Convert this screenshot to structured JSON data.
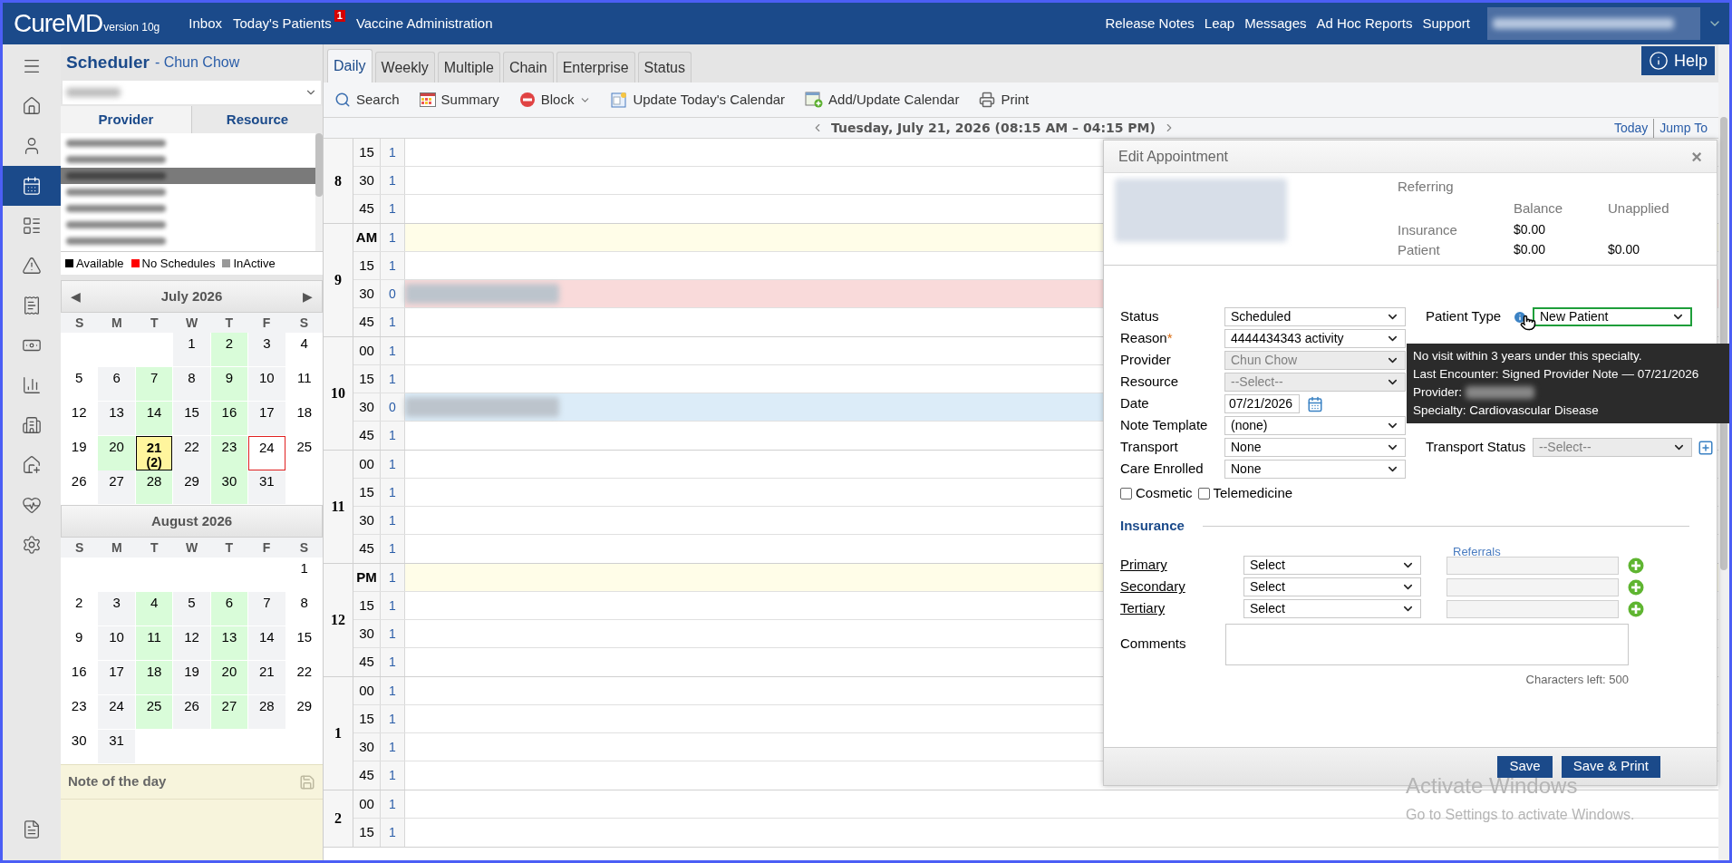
{
  "topbar": {
    "logo": "CureMD",
    "version": "version 10g",
    "links": [
      {
        "label": "Inbox"
      },
      {
        "label": "Today's Patients",
        "badge": "1"
      },
      {
        "label": "Vaccine Administration"
      }
    ],
    "right_links": [
      "Release Notes",
      "Leap",
      "Messages",
      "Ad Hoc Reports",
      "Support"
    ]
  },
  "rail": [
    {
      "kind": "menu",
      "selected": false
    },
    {
      "kind": "home",
      "selected": false
    },
    {
      "kind": "user",
      "selected": false
    },
    {
      "kind": "calendar",
      "selected": true
    },
    {
      "kind": "ledger",
      "selected": false
    },
    {
      "kind": "alert",
      "selected": false
    },
    {
      "kind": "billing",
      "selected": false
    },
    {
      "kind": "payments",
      "selected": false
    },
    {
      "kind": "reports",
      "selected": false
    },
    {
      "kind": "facility",
      "selected": false
    },
    {
      "kind": "homecare",
      "selected": false
    },
    {
      "kind": "health",
      "selected": false
    },
    {
      "kind": "settings",
      "selected": false
    },
    {
      "kind": "notes",
      "selected": false
    }
  ],
  "scheduler": {
    "title": "Scheduler",
    "subtitle": "- Chun Chow"
  },
  "panel_tabs": [
    {
      "label": "Provider",
      "selected": true
    },
    {
      "label": "Resource",
      "selected": false
    }
  ],
  "provider_list": [
    {
      "selected": false
    },
    {
      "selected": false
    },
    {
      "selected": true
    },
    {
      "selected": false
    },
    {
      "selected": false
    },
    {
      "selected": false
    },
    {
      "selected": false
    }
  ],
  "legend": [
    {
      "label": "Available",
      "color": "#000000"
    },
    {
      "label": "No Schedules",
      "color": "#ff0000"
    },
    {
      "label": "InActive",
      "color": "#999999"
    }
  ],
  "months": [
    {
      "title": "July 2026",
      "prev": "◀",
      "next": "▶",
      "weekdays": [
        "S",
        "M",
        "T",
        "W",
        "T",
        "F",
        "S"
      ],
      "weeks": [
        [
          {
            "kind": "empty"
          },
          {
            "kind": "empty"
          },
          {
            "kind": "empty"
          },
          {
            "d": "1",
            "kind": "closed",
            "selected": false
          },
          {
            "d": "2",
            "kind": "open",
            "selected": false
          },
          {
            "d": "3",
            "kind": "closed",
            "selected": false
          },
          {
            "d": "4",
            "kind": "weekend",
            "selected": false
          }
        ],
        [
          {
            "d": "5",
            "kind": "weekend",
            "selected": false
          },
          {
            "d": "6",
            "kind": "closed",
            "selected": false
          },
          {
            "d": "7",
            "kind": "open",
            "selected": false
          },
          {
            "d": "8",
            "kind": "closed",
            "selected": false
          },
          {
            "d": "9",
            "kind": "open",
            "selected": false
          },
          {
            "d": "10",
            "kind": "closed",
            "selected": false
          },
          {
            "d": "11",
            "kind": "weekend",
            "selected": false
          }
        ],
        [
          {
            "d": "12",
            "kind": "weekend",
            "selected": false
          },
          {
            "d": "13",
            "kind": "closed",
            "selected": false
          },
          {
            "d": "14",
            "kind": "open",
            "selected": false
          },
          {
            "d": "15",
            "kind": "closed",
            "selected": false
          },
          {
            "d": "16",
            "kind": "open",
            "selected": false
          },
          {
            "d": "17",
            "kind": "closed",
            "selected": false
          },
          {
            "d": "18",
            "kind": "weekend",
            "selected": false
          }
        ],
        [
          {
            "d": "19",
            "kind": "weekend",
            "selected": false
          },
          {
            "d": "20",
            "kind": "open",
            "selected": false
          },
          {
            "d": "21",
            "selected": true,
            "count": "(2)"
          },
          {
            "d": "22",
            "kind": "closed",
            "selected": false
          },
          {
            "d": "23",
            "kind": "open",
            "selected": false
          },
          {
            "d": "24",
            "kind": "flagged",
            "selected": false
          },
          {
            "d": "25",
            "kind": "weekend",
            "selected": false
          }
        ],
        [
          {
            "d": "26",
            "kind": "weekend",
            "selected": false
          },
          {
            "d": "27",
            "kind": "closed",
            "selected": false
          },
          {
            "d": "28",
            "kind": "open",
            "selected": false
          },
          {
            "d": "29",
            "kind": "closed",
            "selected": false
          },
          {
            "d": "30",
            "kind": "open",
            "selected": false
          },
          {
            "d": "31",
            "kind": "closed",
            "selected": false
          },
          {
            "kind": "empty"
          }
        ]
      ]
    },
    {
      "title": "August 2026",
      "weekdays": [
        "S",
        "M",
        "T",
        "W",
        "T",
        "F",
        "S"
      ],
      "weeks": [
        [
          {
            "kind": "empty"
          },
          {
            "kind": "empty"
          },
          {
            "kind": "empty"
          },
          {
            "kind": "empty"
          },
          {
            "kind": "empty"
          },
          {
            "kind": "empty"
          },
          {
            "d": "1",
            "kind": "weekend",
            "selected": false
          }
        ],
        [
          {
            "d": "2",
            "kind": "weekend",
            "selected": false
          },
          {
            "d": "3",
            "kind": "closed",
            "selected": false
          },
          {
            "d": "4",
            "kind": "open",
            "selected": false
          },
          {
            "d": "5",
            "kind": "closed",
            "selected": false
          },
          {
            "d": "6",
            "kind": "open",
            "selected": false
          },
          {
            "d": "7",
            "kind": "closed",
            "selected": false
          },
          {
            "d": "8",
            "kind": "weekend",
            "selected": false
          }
        ],
        [
          {
            "d": "9",
            "kind": "weekend",
            "selected": false
          },
          {
            "d": "10",
            "kind": "closed",
            "selected": false
          },
          {
            "d": "11",
            "kind": "open",
            "selected": false
          },
          {
            "d": "12",
            "kind": "closed",
            "selected": false
          },
          {
            "d": "13",
            "kind": "open",
            "selected": false
          },
          {
            "d": "14",
            "kind": "closed",
            "selected": false
          },
          {
            "d": "15",
            "kind": "weekend",
            "selected": false
          }
        ],
        [
          {
            "d": "16",
            "kind": "weekend",
            "selected": false
          },
          {
            "d": "17",
            "kind": "closed",
            "selected": false
          },
          {
            "d": "18",
            "kind": "open",
            "selected": false
          },
          {
            "d": "19",
            "kind": "closed",
            "selected": false
          },
          {
            "d": "20",
            "kind": "open",
            "selected": false
          },
          {
            "d": "21",
            "kind": "closed",
            "selected": false
          },
          {
            "d": "22",
            "kind": "weekend",
            "selected": false
          }
        ],
        [
          {
            "d": "23",
            "kind": "weekend",
            "selected": false
          },
          {
            "d": "24",
            "kind": "closed",
            "selected": false
          },
          {
            "d": "25",
            "kind": "open",
            "selected": false
          },
          {
            "d": "26",
            "kind": "closed",
            "selected": false
          },
          {
            "d": "27",
            "kind": "open",
            "selected": false
          },
          {
            "d": "28",
            "kind": "closed",
            "selected": false
          },
          {
            "d": "29",
            "kind": "weekend",
            "selected": false
          }
        ],
        [
          {
            "d": "30",
            "kind": "weekend",
            "selected": false
          },
          {
            "d": "31",
            "kind": "closed",
            "selected": false
          },
          {
            "kind": "empty"
          },
          {
            "kind": "empty"
          },
          {
            "kind": "empty"
          },
          {
            "kind": "empty"
          },
          {
            "kind": "empty"
          }
        ]
      ]
    }
  ],
  "note": {
    "title": "Note of the day"
  },
  "tabs": [
    {
      "label": "Daily",
      "selected": true
    },
    {
      "label": "Weekly",
      "selected": false
    },
    {
      "label": "Multiple",
      "selected": false
    },
    {
      "label": "Chain",
      "selected": false
    },
    {
      "label": "Enterprise",
      "selected": false
    },
    {
      "label": "Status",
      "selected": false
    }
  ],
  "help": "Help",
  "toolbar": [
    {
      "kind": "search",
      "label": "Search"
    },
    {
      "kind": "summary",
      "label": "Summary"
    },
    {
      "kind": "block",
      "label": "Block",
      "dropdown": true
    },
    {
      "kind": "update",
      "label": "Update Today's Calendar"
    },
    {
      "kind": "add",
      "label": "Add/Update Calendar"
    },
    {
      "kind": "print",
      "label": "Print"
    }
  ],
  "date_bar": {
    "title": "Tuesday, July 21, 2026 (08:15 AM – 04:15 PM)",
    "links": [
      "Today",
      "Jump To"
    ]
  },
  "schedule": [
    {
      "hour": "8",
      "slots": [
        {
          "time": "15",
          "count": "1",
          "kind": "open"
        },
        {
          "time": "30",
          "count": "1",
          "kind": "open"
        },
        {
          "time": "45",
          "count": "1",
          "kind": "open"
        }
      ]
    },
    {
      "hour": "9",
      "slots": [
        {
          "time": "AM",
          "count": "1",
          "kind": "meridiem"
        },
        {
          "time": "15",
          "count": "1",
          "kind": "open"
        },
        {
          "time": "30",
          "count": "0",
          "kind": "booked",
          "color": "#f9dada"
        },
        {
          "time": "45",
          "count": "1",
          "kind": "open"
        }
      ]
    },
    {
      "hour": "10",
      "slots": [
        {
          "time": "00",
          "count": "1",
          "kind": "open"
        },
        {
          "time": "15",
          "count": "1",
          "kind": "open"
        },
        {
          "time": "30",
          "count": "0",
          "kind": "booked",
          "color": "#dcecf8"
        },
        {
          "time": "45",
          "count": "1",
          "kind": "open"
        }
      ]
    },
    {
      "hour": "11",
      "slots": [
        {
          "time": "00",
          "count": "1",
          "kind": "open"
        },
        {
          "time": "15",
          "count": "1",
          "kind": "open"
        },
        {
          "time": "30",
          "count": "1",
          "kind": "open"
        },
        {
          "time": "45",
          "count": "1",
          "kind": "open"
        }
      ]
    },
    {
      "hour": "12",
      "slots": [
        {
          "time": "PM",
          "count": "1",
          "kind": "meridiem"
        },
        {
          "time": "15",
          "count": "1",
          "kind": "open"
        },
        {
          "time": "30",
          "count": "1",
          "kind": "open"
        },
        {
          "time": "45",
          "count": "1",
          "kind": "open"
        }
      ]
    },
    {
      "hour": "1",
      "slots": [
        {
          "time": "00",
          "count": "1",
          "kind": "open"
        },
        {
          "time": "15",
          "count": "1",
          "kind": "open"
        },
        {
          "time": "30",
          "count": "1",
          "kind": "open"
        },
        {
          "time": "45",
          "count": "1",
          "kind": "open"
        }
      ]
    },
    {
      "hour": "2",
      "slots": [
        {
          "time": "00",
          "count": "1",
          "kind": "open"
        },
        {
          "time": "15",
          "count": "1",
          "kind": "open"
        }
      ]
    }
  ],
  "dialog": {
    "title": "Edit Appointment",
    "close": "×",
    "referring": "Referring",
    "balance_cols": [
      "Balance",
      "Unapplied"
    ],
    "balance_rows": [
      {
        "label": "Insurance",
        "values": [
          "$0.00"
        ]
      },
      {
        "label": "Patient",
        "values": [
          "$0.00",
          "$0.00"
        ]
      }
    ],
    "fields": [
      {
        "label": "Status",
        "kind": "select",
        "value": "Scheduled",
        "disabled": false
      },
      {
        "label": "Reason",
        "required_mark": "*",
        "kind": "select",
        "value": "4444434343 activity",
        "disabled": false
      },
      {
        "label": "Provider",
        "kind": "select",
        "value": "Chun Chow",
        "disabled": true
      },
      {
        "label": "Resource",
        "kind": "select",
        "value": "--Select--",
        "disabled": true
      },
      {
        "label": "Date",
        "kind": "date",
        "value": "07/21/2026"
      },
      {
        "label": "Note Template",
        "kind": "select",
        "value": "(none)",
        "disabled": false
      },
      {
        "label": "Transport",
        "kind": "select",
        "value": "None",
        "disabled": false
      },
      {
        "label": "Care Enrolled",
        "kind": "select",
        "value": "None",
        "disabled": false
      }
    ],
    "patient_type": {
      "label": "Patient Type",
      "value": "New Patient",
      "focused": true
    },
    "transport_status": {
      "label": "Transport Status",
      "value": "--Select--"
    },
    "checkboxes": [
      {
        "label": "Cosmetic",
        "checked": false
      },
      {
        "label": "Telemedicine",
        "checked": false
      }
    ],
    "insurance": {
      "title": "Insurance",
      "referrals_label": "Referrals",
      "rows": [
        {
          "label": "Primary",
          "value": "Select"
        },
        {
          "label": "Secondary",
          "value": "Select"
        },
        {
          "label": "Tertiary",
          "value": "Select"
        }
      ]
    },
    "comments": {
      "label": "Comments",
      "counter": "Characters left: 500"
    },
    "tooltip": [
      {
        "text": "No visit within 3 years under this specialty."
      },
      {
        "text": "Last Encounter: Signed Provider Note — 07/21/2026"
      },
      {
        "text": "Provider:",
        "redacted": true
      },
      {
        "text": "Specialty: Cardiovascular Disease"
      }
    ],
    "buttons": [
      "Save",
      "Save & Print"
    ]
  },
  "os_overlay": {
    "title": "Activate Windows",
    "subtitle": "Go to Settings to activate Windows."
  }
}
